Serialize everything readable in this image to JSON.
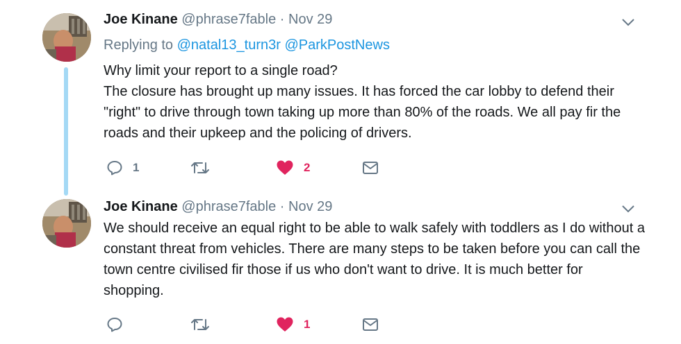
{
  "tweets": [
    {
      "name": "Joe Kinane",
      "handle": "@phrase7fable",
      "separator": "·",
      "date": "Nov 29",
      "replying_to_label": "Replying to",
      "mentions": [
        "@natal13_turn3r",
        "@ParkPostNews"
      ],
      "lines": [
        "Why limit your report to a single road?",
        "The closure has brought up many issues. It has forced the car lobby to defend their \"right\" to drive through town taking up more than 80% of the roads. We all pay fir the roads and their upkeep and the policing of drivers."
      ],
      "reply_count": "1",
      "retweet_count": "",
      "like_count": "2",
      "liked": true
    },
    {
      "name": "Joe Kinane",
      "handle": "@phrase7fable",
      "separator": "·",
      "date": "Nov 29",
      "lines": [
        "We should receive an equal right to be able to walk safely with toddlers as I do without a constant threat from vehicles. There are many steps to be taken before you can call the town centre civilised fir those if us who don't want to drive. It is much better for shopping."
      ],
      "reply_count": "",
      "retweet_count": "",
      "like_count": "1",
      "liked": true
    }
  ],
  "colors": {
    "text": "#14171a",
    "secondary": "#657786",
    "link": "#1b95e0",
    "like": "#e0245e",
    "thread_line": "#a4d9f5"
  },
  "icons": {
    "reply": "reply-icon",
    "retweet": "retweet-icon",
    "like": "heart-icon",
    "dm": "envelope-icon",
    "menu": "chevron-down-icon"
  }
}
